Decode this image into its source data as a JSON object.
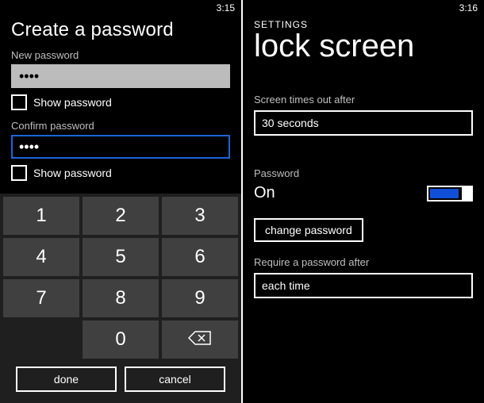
{
  "left": {
    "time": "3:15",
    "title": "Create a password",
    "new_password_label": "New password",
    "new_password_value": "••••",
    "show_password_1": "Show password",
    "confirm_password_label": "Confirm password",
    "confirm_password_value": "••••",
    "show_password_2": "Show password",
    "keys": {
      "k1": "1",
      "k2": "2",
      "k3": "3",
      "k4": "4",
      "k5": "5",
      "k6": "6",
      "k7": "7",
      "k8": "8",
      "k9": "9",
      "k0": "0"
    },
    "done": "done",
    "cancel": "cancel"
  },
  "right": {
    "time": "3:16",
    "header": "SETTINGS",
    "title": "lock screen",
    "timeout_label": "Screen times out after",
    "timeout_value": "30 seconds",
    "password_label": "Password",
    "password_state": "On",
    "change_password": "change password",
    "require_label": "Require a password after",
    "require_value": "each time"
  }
}
